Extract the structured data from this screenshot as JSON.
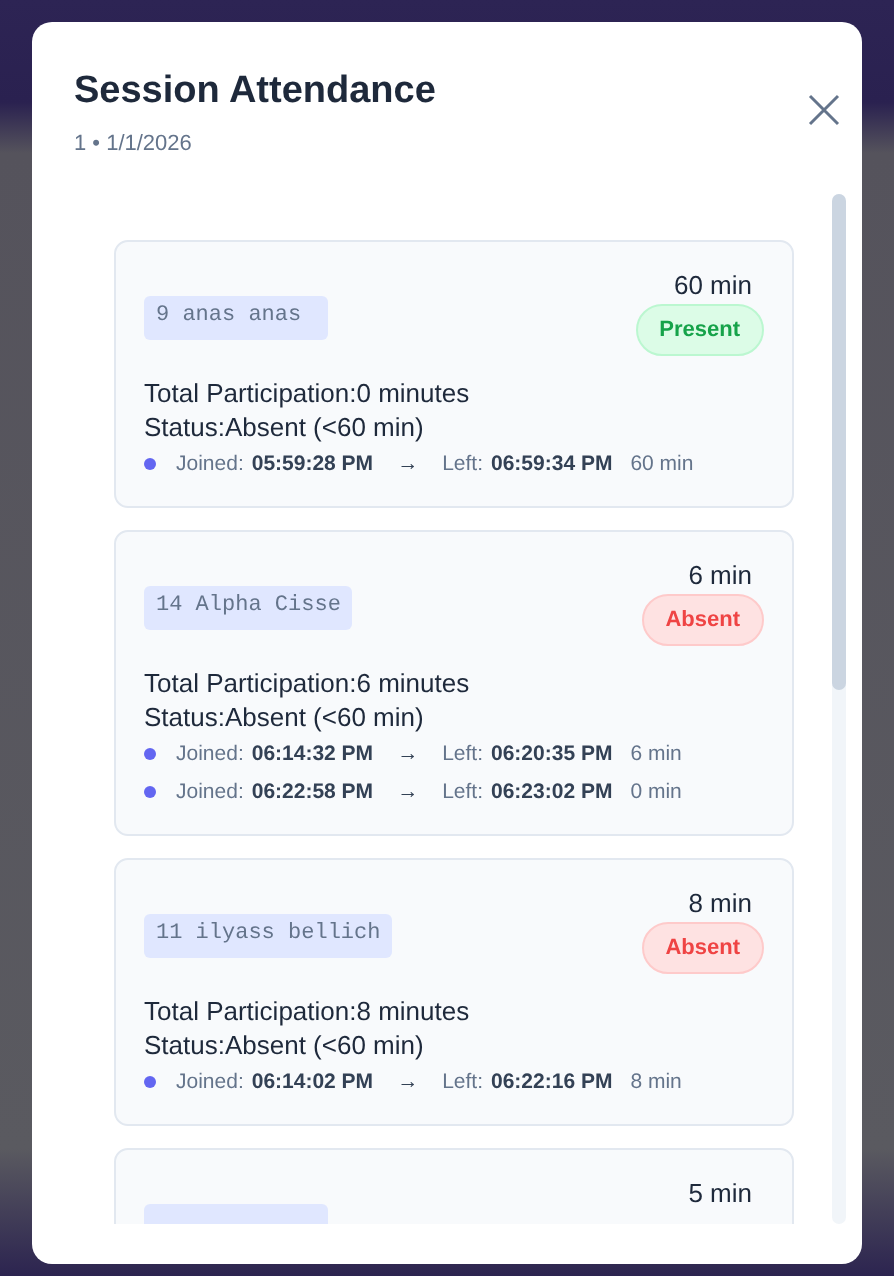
{
  "dialog": {
    "title": "Session Attendance",
    "subtitle": "1 • 1/1/2026"
  },
  "students": [
    {
      "name": "9 anas anas",
      "duration": "60 min",
      "status": {
        "label": "Present",
        "kind": "present"
      },
      "total": "Total Participation:0 minutes",
      "status_line": "Status:Absent (<60 min)",
      "sessions": [
        {
          "joined_label": "Joined:",
          "joined": "05:59:28 PM",
          "arrow": "→",
          "left_label": "Left:",
          "left": "06:59:34 PM",
          "minutes": "60 min"
        }
      ]
    },
    {
      "name": "14 Alpha Cisse",
      "duration": "6 min",
      "status": {
        "label": "Absent",
        "kind": "absent"
      },
      "total": "Total Participation:6 minutes",
      "status_line": "Status:Absent (<60 min)",
      "sessions": [
        {
          "joined_label": "Joined:",
          "joined": "06:14:32 PM",
          "arrow": "→",
          "left_label": "Left:",
          "left": "06:20:35 PM",
          "minutes": "6 min"
        },
        {
          "joined_label": "Joined:",
          "joined": "06:22:58 PM",
          "arrow": "→",
          "left_label": "Left:",
          "left": "06:23:02 PM",
          "minutes": "0 min"
        }
      ]
    },
    {
      "name": "11 ilyass bellich",
      "duration": "8 min",
      "status": {
        "label": "Absent",
        "kind": "absent"
      },
      "total": "Total Participation:8 minutes",
      "status_line": "Status:Absent (<60 min)",
      "sessions": [
        {
          "joined_label": "Joined:",
          "joined": "06:14:02 PM",
          "arrow": "→",
          "left_label": "Left:",
          "left": "06:22:16 PM",
          "minutes": "8 min"
        }
      ]
    },
    {
      "duration": "5 min"
    }
  ]
}
